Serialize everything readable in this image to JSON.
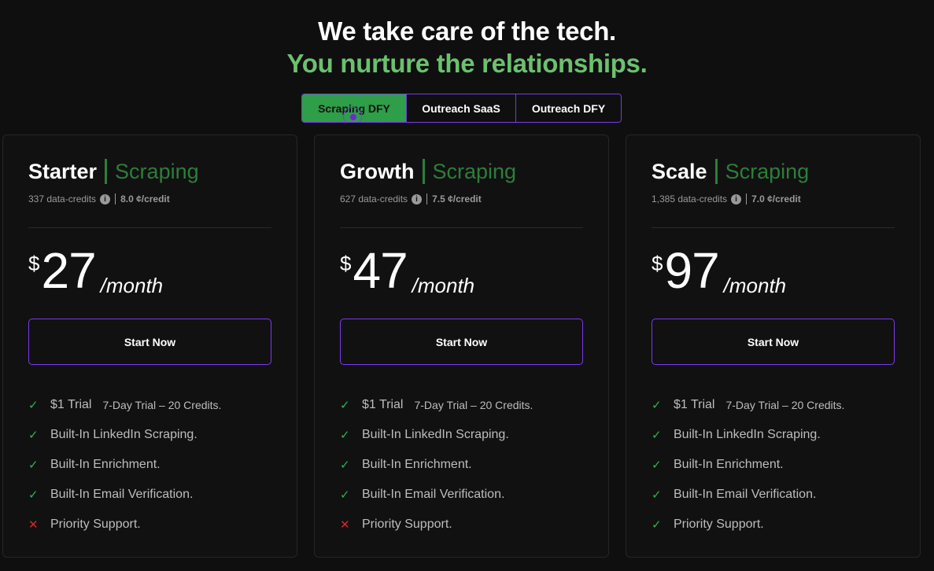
{
  "hero": {
    "line1": "We take care of the tech.",
    "line2": "You nurture the relationships."
  },
  "tabs": [
    {
      "label": "Scraping DFY",
      "active": true
    },
    {
      "label": "Outreach SaaS",
      "active": false
    },
    {
      "label": "Outreach DFY",
      "active": false
    }
  ],
  "colors": {
    "background": "#0f0f10",
    "accent_green": "#6cc06e",
    "active_tab": "#2e9e48",
    "border_purple": "#7c3aed",
    "check": "#2fb350",
    "cross": "#e02424"
  },
  "plans": [
    {
      "name": "Starter",
      "type": "Scraping",
      "credits": "337 data-credits",
      "rate": "8.0 ¢/credit",
      "currency": "$",
      "price": "27",
      "period": "/month",
      "cta": "Start Now",
      "features": [
        {
          "icon": "check",
          "mark": "✓",
          "text": "$1 Trial",
          "note": "7-Day Trial – 20 Credits."
        },
        {
          "icon": "check",
          "mark": "✓",
          "text": "Built-In LinkedIn Scraping.",
          "note": ""
        },
        {
          "icon": "check",
          "mark": "✓",
          "text": "Built-In Enrichment.",
          "note": ""
        },
        {
          "icon": "check",
          "mark": "✓",
          "text": "Built-In Email Verification.",
          "note": ""
        },
        {
          "icon": "cross",
          "mark": "✕",
          "text": "Priority Support.",
          "note": ""
        }
      ]
    },
    {
      "name": "Growth",
      "type": "Scraping",
      "credits": "627 data-credits",
      "rate": "7.5 ¢/credit",
      "currency": "$",
      "price": "47",
      "period": "/month",
      "cta": "Start Now",
      "features": [
        {
          "icon": "check",
          "mark": "✓",
          "text": "$1 Trial",
          "note": "7-Day Trial – 20 Credits."
        },
        {
          "icon": "check",
          "mark": "✓",
          "text": "Built-In LinkedIn Scraping.",
          "note": ""
        },
        {
          "icon": "check",
          "mark": "✓",
          "text": "Built-In Enrichment.",
          "note": ""
        },
        {
          "icon": "check",
          "mark": "✓",
          "text": "Built-In Email Verification.",
          "note": ""
        },
        {
          "icon": "cross",
          "mark": "✕",
          "text": "Priority Support.",
          "note": ""
        }
      ]
    },
    {
      "name": "Scale",
      "type": "Scraping",
      "credits": "1,385 data-credits",
      "rate": "7.0 ¢/credit",
      "currency": "$",
      "price": "97",
      "period": "/month",
      "cta": "Start Now",
      "features": [
        {
          "icon": "check",
          "mark": "✓",
          "text": "$1 Trial",
          "note": "7-Day Trial – 20 Credits."
        },
        {
          "icon": "check",
          "mark": "✓",
          "text": "Built-In LinkedIn Scraping.",
          "note": ""
        },
        {
          "icon": "check",
          "mark": "✓",
          "text": "Built-In Enrichment.",
          "note": ""
        },
        {
          "icon": "check",
          "mark": "✓",
          "text": "Built-In Email Verification.",
          "note": ""
        },
        {
          "icon": "check",
          "mark": "✓",
          "text": "Priority Support.",
          "note": ""
        }
      ]
    }
  ]
}
